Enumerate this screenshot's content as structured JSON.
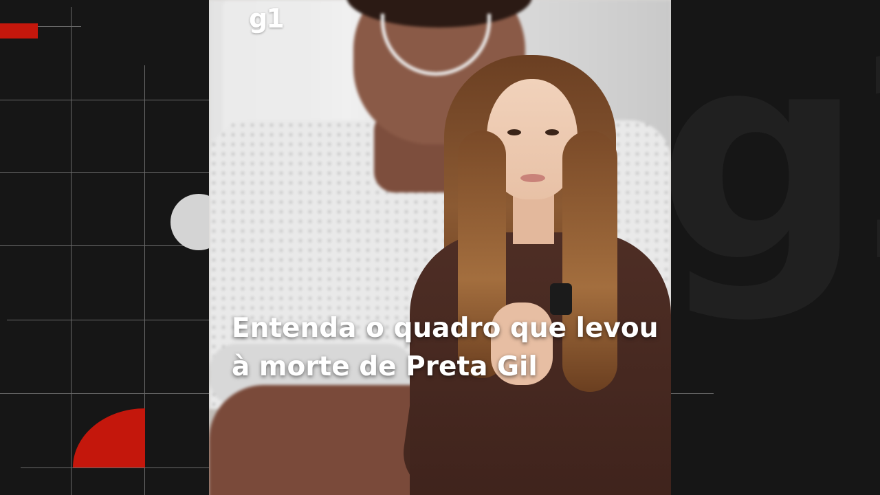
{
  "brand": {
    "logo_text": "g1",
    "watermark_text": "g1",
    "accent_color": "#c4170c"
  },
  "video": {
    "headline_line1": "Entenda o quadro que levou",
    "headline_line2": "à morte de Preta Gil"
  },
  "colors": {
    "background": "#161616",
    "grid_lines": "#6a6a6a",
    "decor_gray": "#d4d4d4"
  }
}
